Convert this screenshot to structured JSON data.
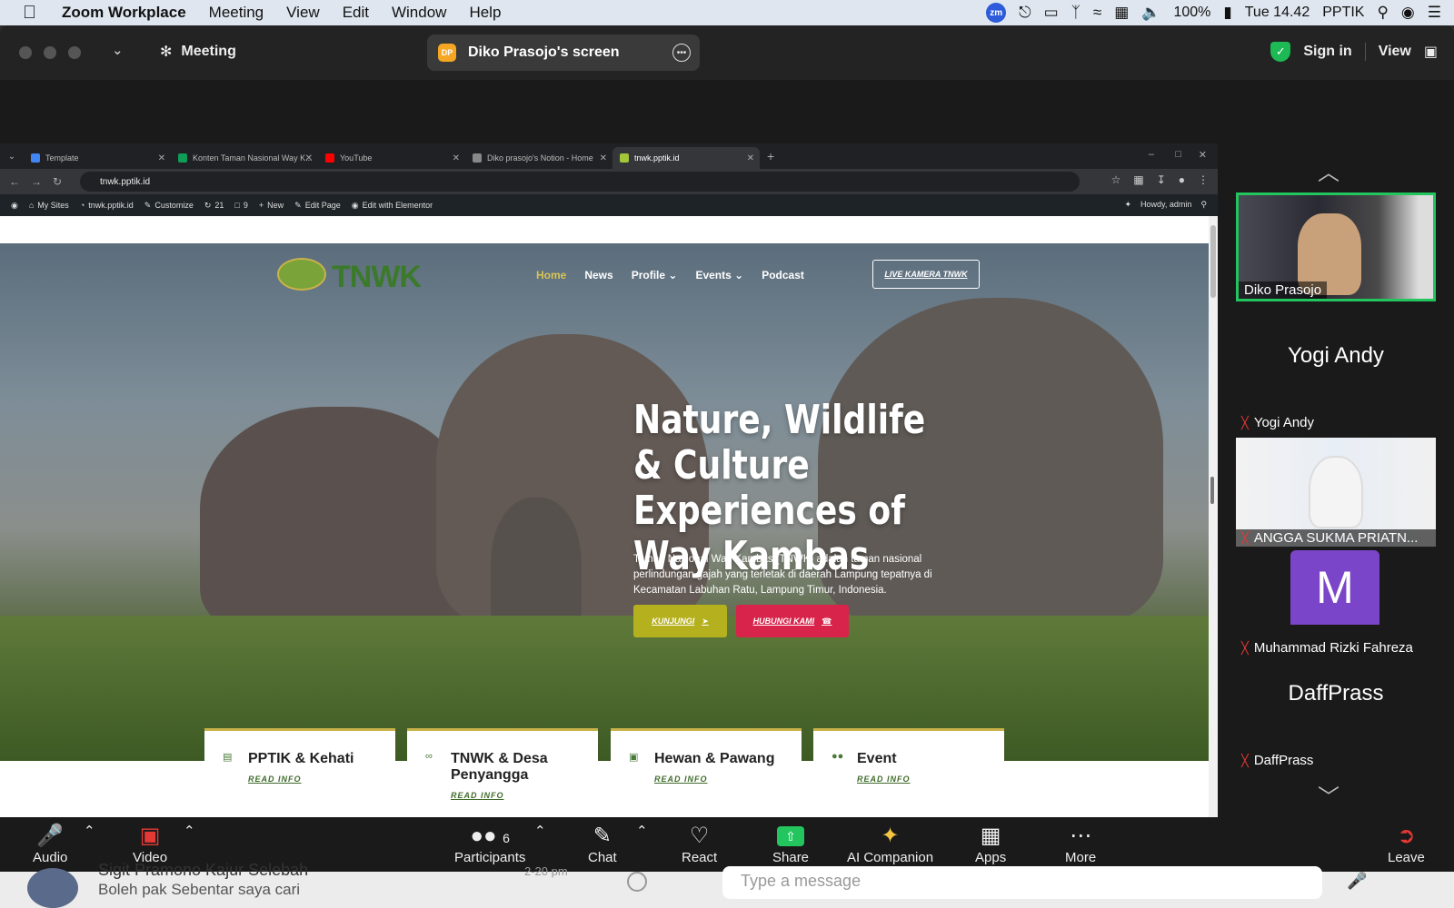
{
  "menubar": {
    "items": [
      "Zoom Workplace",
      "Meeting",
      "View",
      "Edit",
      "Window",
      "Help"
    ],
    "zm": "zm",
    "battery": "100%",
    "time": "Tue 14.42",
    "user": "PPTIK"
  },
  "zoom": {
    "meeting_label": "Meeting",
    "share_initials": "DP",
    "share_title": "Diko Prasojo's screen",
    "sign_in": "Sign in",
    "view": "View"
  },
  "browser": {
    "tabs": [
      {
        "label": "Template",
        "color": "#4285f4"
      },
      {
        "label": "Konten Taman Nasional Way K...",
        "color": "#0f9d58"
      },
      {
        "label": "YouTube",
        "color": "#ff0000"
      },
      {
        "label": "Diko prasojo's Notion - Home",
        "color": "#888888"
      },
      {
        "label": "tnwk.pptik.id",
        "color": "#a4c639"
      }
    ],
    "url": "tnwk.pptik.id",
    "wpbar": {
      "my_sites": "My Sites",
      "site": "tnwk.pptik.id",
      "customize": "Customize",
      "updates": "21",
      "comments": "9",
      "new": "New",
      "edit_page": "Edit Page",
      "elementor": "Edit with Elementor",
      "howdy": "Howdy, admin"
    }
  },
  "site": {
    "logo": "TNWK",
    "nav": [
      "Home",
      "News",
      "Profile",
      "Events",
      "Podcast"
    ],
    "live_btn": "LIVE KAMERA TNWK",
    "hero_title": "Nature, Wildlife & Culture Experiences of Way Kambas",
    "hero_desc": "Taman Nasional Way Kambas (TNWK) adalah taman nasional perlindungan gajah yang terletak di daerah Lampung tepatnya di Kecamatan Labuhan Ratu, Lampung Timur, Indonesia.",
    "btn_kunjungi": "KUNJUNGI",
    "btn_hubungi": "HUBUNGI KAMI",
    "cards": [
      {
        "title": "PPTIK & Kehati",
        "read": "READ INFO"
      },
      {
        "title": "TNWK & Desa Penyangga",
        "read": "READ INFO"
      },
      {
        "title": "Hewan & Pawang",
        "read": "READ INFO"
      },
      {
        "title": "Event",
        "read": "READ INFO"
      }
    ]
  },
  "participants_gallery": [
    {
      "name": "Diko Prasojo",
      "type": "video",
      "speaking": true
    },
    {
      "name": "Yogi Andy",
      "type": "name"
    },
    {
      "name": "ANGGA SUKMA PRIATN...",
      "type": "video"
    },
    {
      "name": "Muhammad Rizki Fahreza",
      "type": "avatar",
      "initial": "M"
    },
    {
      "name": "DaffPrass",
      "type": "name"
    }
  ],
  "toolbar": {
    "audio": "Audio",
    "video": "Video",
    "participants": "Participants",
    "participants_count": "6",
    "chat": "Chat",
    "react": "React",
    "share": "Share",
    "ai": "AI Companion",
    "apps": "Apps",
    "more": "More",
    "leave": "Leave"
  },
  "chat_strip": {
    "sender": "Sigit Pramono Kajur Selebah",
    "time": "2-20 pm",
    "message": "Boleh pak Sebentar saya cari",
    "input_placeholder": "Type a message"
  }
}
